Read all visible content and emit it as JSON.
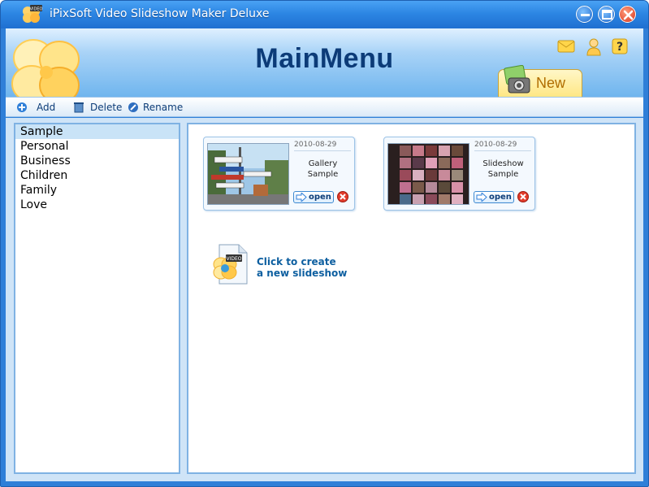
{
  "window": {
    "title": "iPixSoft Video Slideshow Maker Deluxe",
    "logo_badge": "VIDEO"
  },
  "header": {
    "title": "MainMenu",
    "new_label": "New",
    "icons": [
      "message-icon",
      "user-icon",
      "help-icon"
    ]
  },
  "toolbar": {
    "add_label": "Add",
    "delete_label": "Delete",
    "rename_label": "Rename"
  },
  "categories": [
    {
      "label": "Sample",
      "selected": true
    },
    {
      "label": "Personal"
    },
    {
      "label": "Business"
    },
    {
      "label": "Children"
    },
    {
      "label": "Family"
    },
    {
      "label": "Love"
    }
  ],
  "slideshows": [
    {
      "date": "2010-08-29",
      "name_line1": "Gallery",
      "name_line2": "Sample",
      "open_label": "open"
    },
    {
      "date": "2010-08-29",
      "name_line1": "Slideshow",
      "name_line2": "Sample",
      "open_label": "open"
    }
  ],
  "create": {
    "line1": "Click to create",
    "line2": "a new slideshow",
    "badge": "VIDEO"
  },
  "colors": {
    "title_bar": "#2c86e3",
    "header_title": "#0c3b78",
    "selection": "#c9e3f7",
    "panel_border": "#7fb2e3",
    "link_text": "#0d5fa0"
  }
}
